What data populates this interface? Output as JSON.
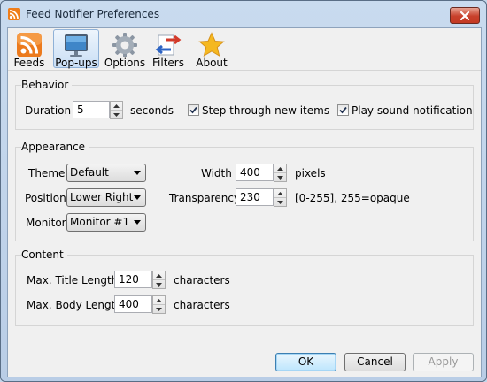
{
  "window": {
    "title": "Feed Notifier Preferences",
    "app_icon": "rss-feed-icon",
    "close_icon": "close-icon"
  },
  "toolbar": {
    "items": [
      {
        "label": "Feeds",
        "icon": "rss-feed-icon"
      },
      {
        "label": "Pop-ups",
        "icon": "monitor-icon",
        "active": true
      },
      {
        "label": "Options",
        "icon": "gear-icon"
      },
      {
        "label": "Filters",
        "icon": "filter-arrows-icon"
      },
      {
        "label": "About",
        "icon": "star-icon"
      }
    ]
  },
  "behavior": {
    "title": "Behavior",
    "duration_label": "Duration",
    "duration_value": "5",
    "duration_unit": "seconds",
    "step_label": "Step through new items",
    "step_checked": true,
    "sound_label": "Play sound notification",
    "sound_checked": true
  },
  "appearance": {
    "title": "Appearance",
    "theme_label": "Theme",
    "theme_value": "Default",
    "position_label": "Position",
    "position_value": "Lower Right",
    "monitor_label": "Monitor",
    "monitor_value": "Monitor #1",
    "width_label": "Width",
    "width_value": "400",
    "width_unit": "pixels",
    "transparency_label": "Transparency",
    "transparency_value": "230",
    "transparency_hint": "[0-255], 255=opaque"
  },
  "content": {
    "title": "Content",
    "title_len_label": "Max. Title Length",
    "title_len_value": "120",
    "title_len_unit": "characters",
    "body_len_label": "Max. Body Length",
    "body_len_value": "400",
    "body_len_unit": "characters"
  },
  "footer": {
    "ok": "OK",
    "cancel": "Cancel",
    "apply": "Apply"
  },
  "colors": {
    "accent": "#3c7fb1",
    "rss_orange": "#ef7d1a",
    "close_red": "#c8402b"
  }
}
